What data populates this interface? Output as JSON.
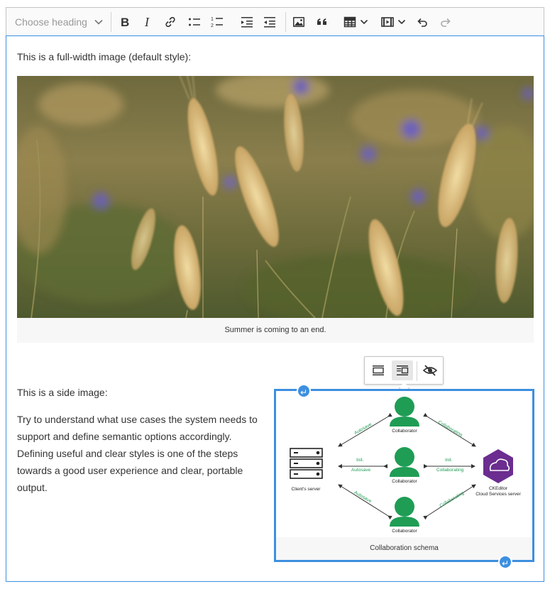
{
  "toolbar": {
    "heading_placeholder": "Choose heading",
    "buttons": [
      "bold",
      "italic",
      "link",
      "bulleted-list",
      "numbered-list",
      "outdent",
      "indent",
      "insert-image",
      "block-quote",
      "insert-table",
      "insert-media",
      "undo",
      "redo"
    ]
  },
  "content": {
    "intro_text": "This is a full-width image (default style):",
    "full_image_caption": "Summer is coming to an end.",
    "side_label": "This is a side image:",
    "side_paragraph": "Try to understand what use cases the system needs to support and define semantic options accordingly. Defining useful and clear styles is one of the steps towards a good user experience and clear, portable output.",
    "side_image_caption": "Collaboration schema"
  },
  "diagram": {
    "collaborator_label": "Collaborator",
    "client_server_label": "Client's server",
    "ckeditor_label_1": "CKEditor",
    "ckeditor_label_2": "Cloud Services server",
    "autosave": "Autosave",
    "init": "Init.",
    "collaborating": "Collaborating"
  },
  "colors": {
    "accent_blue": "#3d8fe0",
    "collaborator_green": "#1f9d55",
    "ckeditor_purple": "#6b2d8f"
  }
}
